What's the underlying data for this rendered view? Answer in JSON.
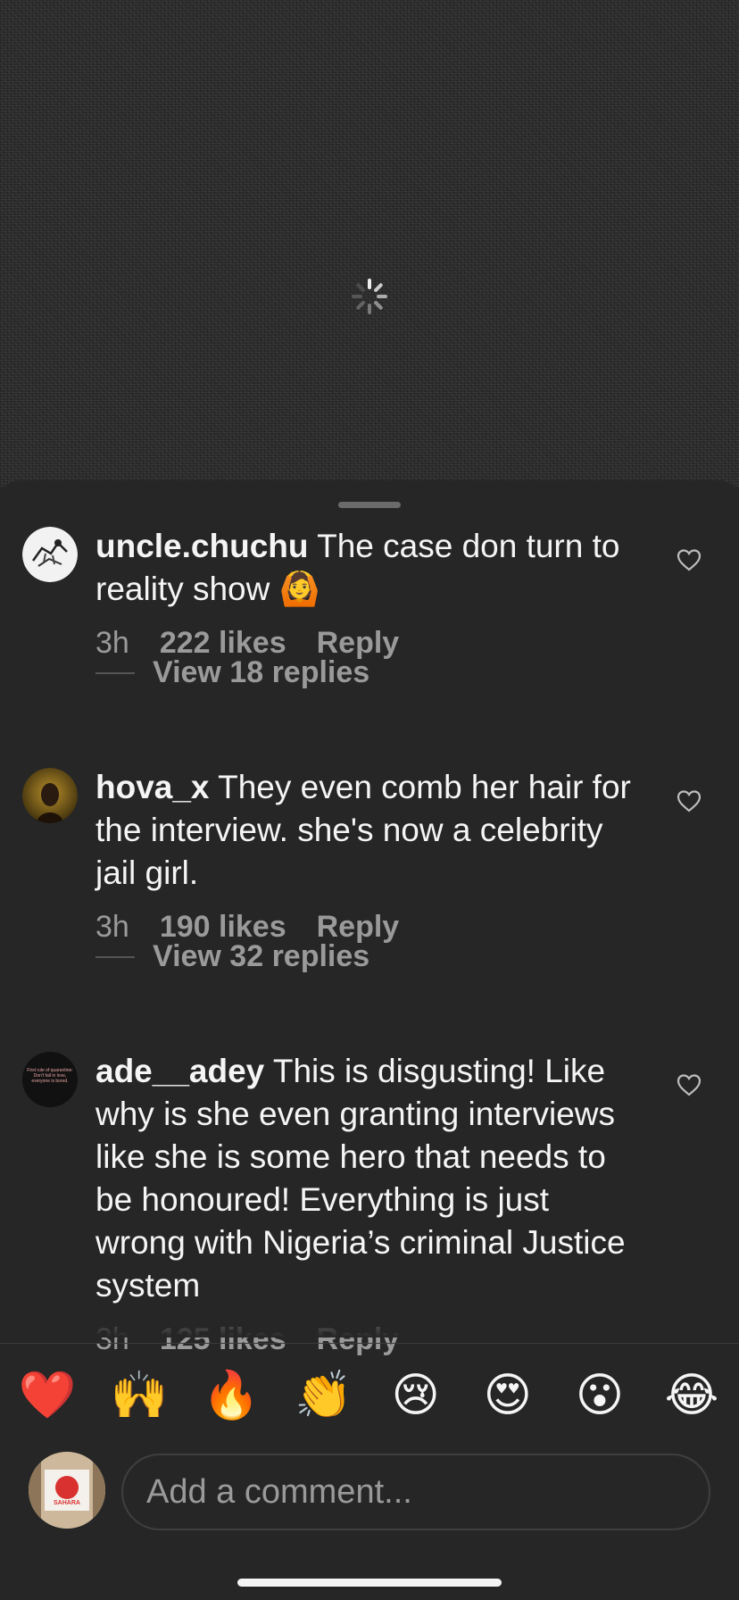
{
  "comments": [
    {
      "username": "uncle.chuchu",
      "text": " The case don turn to reality show 🙆",
      "time": "3h",
      "likes": "222 likes",
      "reply_label": "Reply",
      "view_replies": "View 18 replies"
    },
    {
      "username": "hova_x",
      "text": " They even comb her hair for the interview. she's now a celebrity jail girl.",
      "time": "3h",
      "likes": "190 likes",
      "reply_label": "Reply",
      "view_replies": "View 32 replies"
    },
    {
      "username": "ade__adey",
      "text": " This is disgusting! Like why is she even granting interviews like she is some hero that needs to be honoured! Everything is just wrong with Nigeria’s criminal Justice system",
      "time": "3h",
      "likes": "125 likes",
      "reply_label": "Reply"
    }
  ],
  "avatar_text": {
    "ade__adey": "First rule of quarantine: Don't fall in love, everyone is bored."
  },
  "my_avatar_text": "SAHARA",
  "emoji_bar": [
    "❤️",
    "🙌",
    "🔥",
    "👏",
    "😢",
    "😍",
    "😮",
    "😂"
  ],
  "composer": {
    "placeholder": "Add a comment..."
  },
  "icons": {
    "loading": "loading-spinner-icon",
    "like": "heart-outline-icon"
  },
  "colors": {
    "background": "#262626",
    "muted_text": "#9a9a9a",
    "primary_text": "#f5f5f5"
  }
}
